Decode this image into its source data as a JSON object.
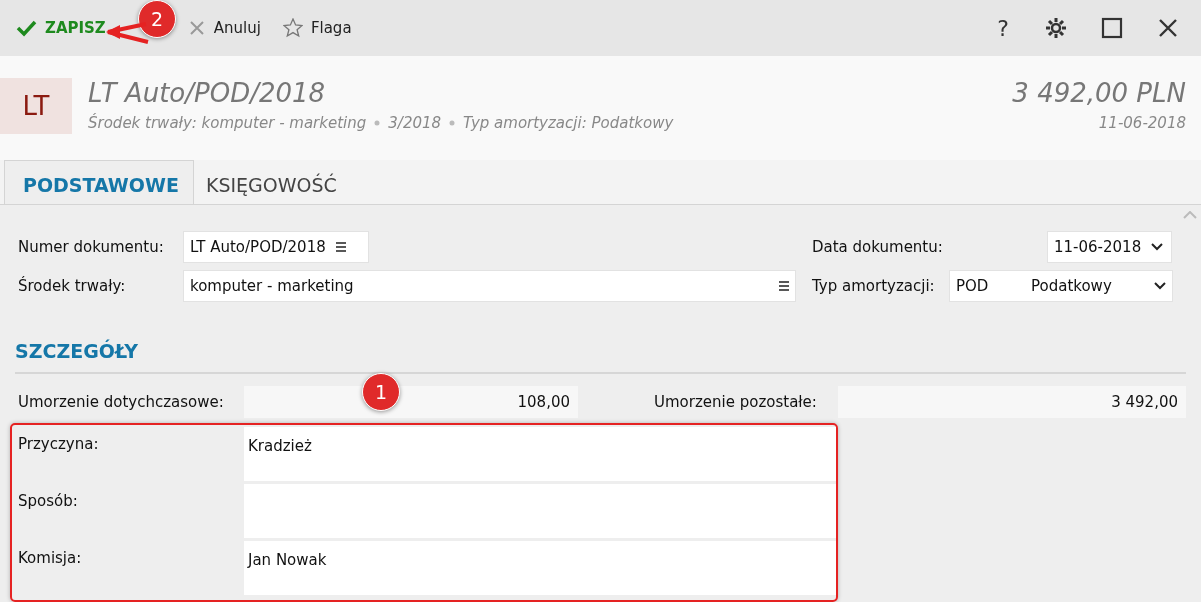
{
  "toolbar": {
    "buttons": [
      {
        "kind": "save",
        "label": "ZAPISZ"
      },
      {
        "kind": "cancel",
        "label": "Anuluj"
      },
      {
        "kind": "flag",
        "label": "Flaga"
      }
    ],
    "help": "?"
  },
  "header": {
    "badge": "LT",
    "title": "LT Auto/POD/2018",
    "subtitle_parts": [
      "Środek trwały: komputer - marketing",
      "3/2018",
      "Typ amortyzacji: Podatkowy"
    ],
    "amount": "3 492,00 PLN",
    "date": "11-06-2018"
  },
  "tabs": [
    {
      "label": "PODSTAWOWE",
      "selected": true
    },
    {
      "label": "KSIĘGOWOŚĆ",
      "selected": false
    }
  ],
  "form": {
    "document_number": {
      "label": "Numer dokumentu:",
      "value": "LT Auto/POD/2018"
    },
    "fixed_asset": {
      "label": "Środek trwały:",
      "value": "komputer - marketing"
    },
    "document_date": {
      "label": "Data dokumentu:",
      "value": "11-06-2018"
    },
    "depreciation_type": {
      "label": "Typ amortyzacji:",
      "code": "POD",
      "name": "Podatkowy"
    }
  },
  "details": {
    "title": "SZCZEGÓŁY",
    "amounts": [
      {
        "label": "Umorzenie dotychczasowe:",
        "value": "108,00"
      },
      {
        "label": "Umorzenie pozostałe:",
        "value": "3 492,00"
      }
    ],
    "fields": [
      {
        "label": "Przyczyna:",
        "value": "Kradzież"
      },
      {
        "label": "Sposób:"
      },
      {
        "label": "Komisja:",
        "value": "Jan Nowak"
      }
    ]
  },
  "annotations": [
    "1",
    "2"
  ]
}
